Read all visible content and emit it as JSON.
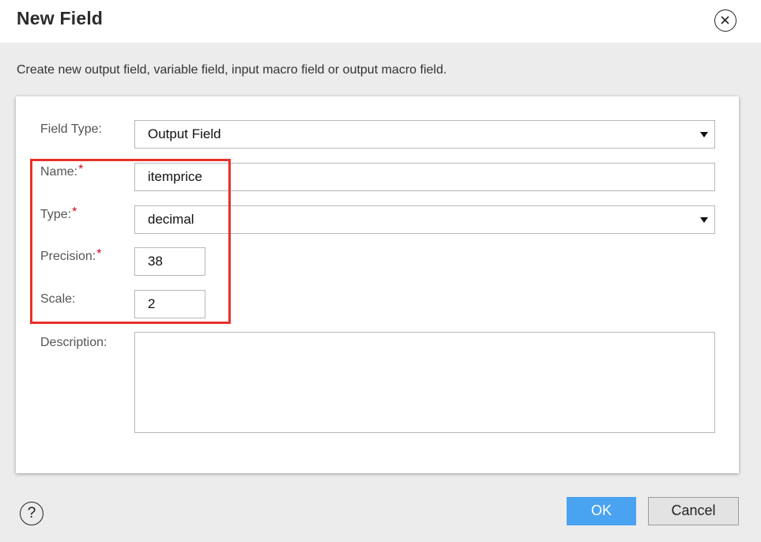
{
  "dialog": {
    "title": "New Field",
    "subtitle": "Create new output field, variable field, input macro field or output macro field."
  },
  "form": {
    "field_type": {
      "label": "Field Type:",
      "value": "Output Field"
    },
    "name": {
      "label": "Name:",
      "required_mark": "*",
      "value": "itemprice"
    },
    "type": {
      "label": "Type:",
      "required_mark": "*",
      "value": "decimal"
    },
    "precision": {
      "label": "Precision:",
      "required_mark": "*",
      "value": "38"
    },
    "scale": {
      "label": "Scale:",
      "value": "2"
    },
    "description": {
      "label": "Description:",
      "value": ""
    }
  },
  "footer": {
    "help_label": "?",
    "ok_label": "OK",
    "cancel_label": "Cancel"
  },
  "colors": {
    "primary_button": "#4aa3f0",
    "required": "#d0021b",
    "highlight_box": "#e8302a"
  },
  "icons": {
    "close": "close-circle-icon",
    "dropdown": "caret-down-icon",
    "help": "help-circle-icon"
  }
}
